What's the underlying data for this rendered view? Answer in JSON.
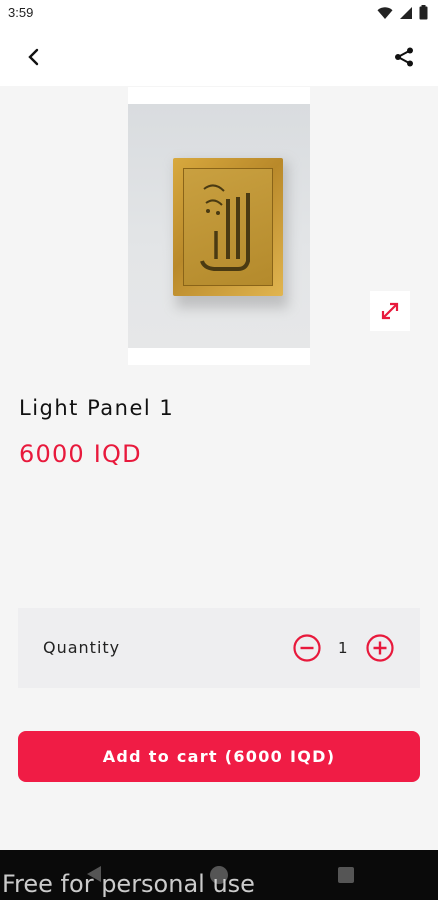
{
  "status_bar": {
    "time": "3:59"
  },
  "product": {
    "title": "Light Panel 1",
    "price": "6000 IQD",
    "image_description": ""
  },
  "quantity": {
    "label": "Quantity",
    "value": "1"
  },
  "cart": {
    "button_label": "Add to cart (6000 IQD)"
  },
  "watermark": {
    "text": "Free for personal use"
  },
  "colors": {
    "accent": "#f01c45",
    "price": "#e8193c",
    "background": "#f5f5f5"
  }
}
